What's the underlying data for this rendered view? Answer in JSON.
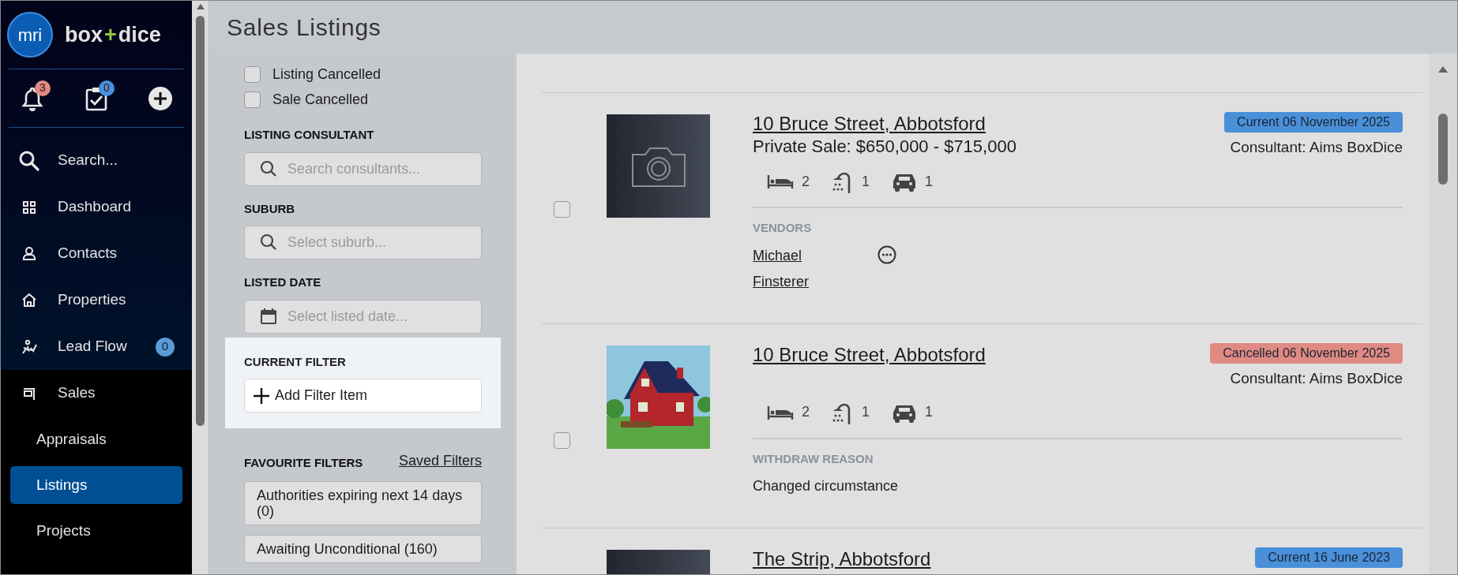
{
  "brand": {
    "badge": "mri",
    "name_left": "box",
    "name_plus": "+",
    "name_right": "dice"
  },
  "quick_actions": [
    {
      "kind": "bell",
      "badge": "3",
      "color": "#e08a84"
    },
    {
      "kind": "tasks",
      "badge": "0",
      "color": "#4a90d9"
    },
    {
      "kind": "add"
    }
  ],
  "nav": [
    {
      "kind": "search",
      "label": "Search...",
      "selected": false
    },
    {
      "kind": "dashboard",
      "label": "Dashboard",
      "selected": false
    },
    {
      "kind": "contacts",
      "label": "Contacts",
      "selected": false
    },
    {
      "kind": "properties",
      "label": "Properties",
      "selected": false
    },
    {
      "kind": "leadflow",
      "label": "Lead Flow",
      "selected": false,
      "badge": "0"
    },
    {
      "kind": "sales",
      "label": "Sales",
      "selected": false,
      "children": [
        {
          "label": "Appraisals",
          "selected": false
        },
        {
          "label": "Listings",
          "selected": true
        },
        {
          "label": "Projects",
          "selected": false
        }
      ]
    }
  ],
  "page_title": "Sales Listings",
  "filters": {
    "checkboxes": [
      {
        "label": "Listing Cancelled",
        "checked": false
      },
      {
        "label": "Sale Cancelled",
        "checked": false
      }
    ],
    "fields": [
      {
        "heading": "LISTING CONSULTANT",
        "kind": "search",
        "placeholder": "Search consultants..."
      },
      {
        "heading": "SUBURB",
        "kind": "search",
        "placeholder": "Select suburb..."
      },
      {
        "heading": "LISTED DATE",
        "kind": "date",
        "placeholder": "Select listed date..."
      }
    ],
    "current_filter": {
      "heading": "CURRENT FILTER",
      "button": "Add Filter Item"
    },
    "favourites": {
      "heading": "FAVOURITE FILTERS",
      "link": "Saved Filters",
      "items": [
        "Authorities expiring next 14 days (0)",
        "Awaiting Unconditional (160)"
      ]
    }
  },
  "listings": [
    {
      "checked": false,
      "kind": "no-photo",
      "address": "10 Bruce Street, Abbotsford",
      "price": "Private Sale: $650,000 - $715,000",
      "beds": "2",
      "baths": "1",
      "cars": "1",
      "status": "Current 06 November 2025",
      "color": "#4a90d9",
      "consultant": "Consultant: Aims BoxDice",
      "section": {
        "kind": "vendors",
        "heading": "VENDORS",
        "names": [
          "Michael",
          "Finsterer"
        ]
      }
    },
    {
      "checked": false,
      "kind": "house-picture",
      "address": "10 Bruce Street, Abbotsford",
      "beds": "2",
      "baths": "1",
      "cars": "1",
      "status": "Cancelled 06 November 2025",
      "color": "#e08a84",
      "consultant": "Consultant: Aims BoxDice",
      "section": {
        "kind": "reason",
        "heading": "WITHDRAW REASON",
        "text": "Changed circumstance"
      }
    },
    {
      "kind": "no-photo",
      "address": "The Strip, Abbotsford",
      "status": "Current 16 June 2023",
      "color": "#4a90d9"
    }
  ]
}
